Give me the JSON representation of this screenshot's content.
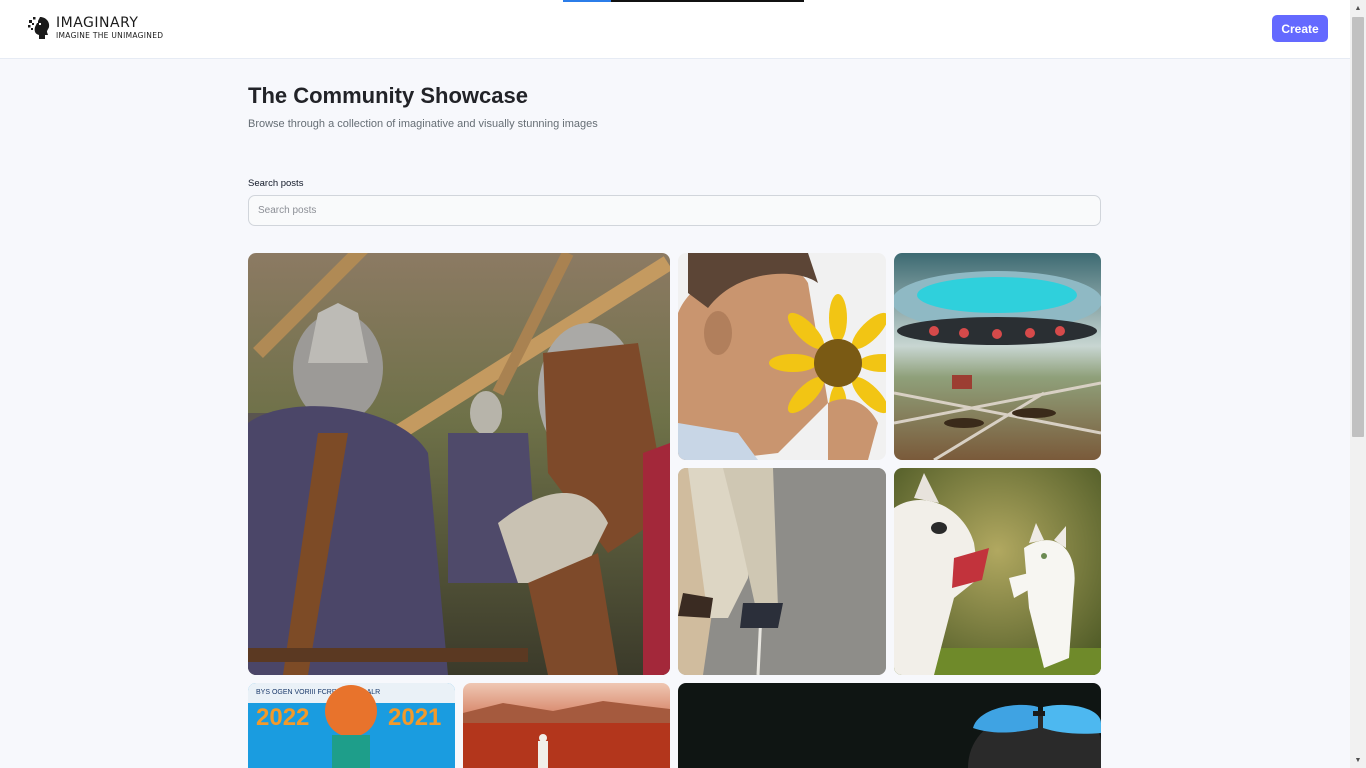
{
  "header": {
    "brand": "IMAGINARY",
    "tagline": "IMAGINE THE UNIMAGINED",
    "create_label": "Create"
  },
  "main": {
    "title": "The Community Showcase",
    "subtitle": "Browse through a collection of imaginative and visually stunning images"
  },
  "search": {
    "label": "Search posts",
    "placeholder": "Search posts",
    "value": ""
  },
  "gallery": {
    "posts": [
      {
        "icon": "medieval-knights-image",
        "poster_year_left": "2022",
        "poster_year_right": "2021",
        "poster_header": "BYS OGEN VORIII  FCRR POT YIDALR"
      },
      {
        "icon": "man-smelling-sunflower-image"
      },
      {
        "icon": "ufo-over-farmland-image"
      },
      {
        "icon": "person-walking-on-road-image"
      },
      {
        "icon": "dog-barking-at-cat-image"
      },
      {
        "icon": "olympic-poster-image"
      },
      {
        "icon": "mars-landscape-image"
      },
      {
        "icon": "person-with-sunglasses-image"
      }
    ]
  },
  "colors": {
    "accent": "#6469ff",
    "background": "#f7f8fc",
    "title": "#222328",
    "subtitle": "#666e75"
  }
}
